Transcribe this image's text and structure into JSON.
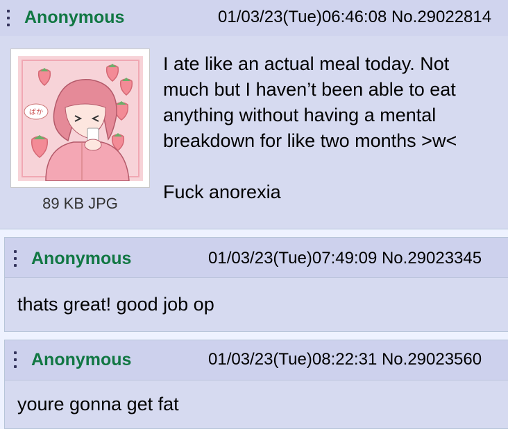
{
  "op": {
    "name": "Anonymous",
    "datetime": "01/03/23(Tue)06:46:08",
    "number": "No.29022814",
    "file_info": "89 KB JPG",
    "message_lines": [
      "I ate like an actual meal today. Not",
      "much but I haven’t been able to eat",
      "anything without having a mental",
      "breakdown for like two months >w<"
    ],
    "message_footer": "Fuck anorexia",
    "thumbnail_text": "ばか"
  },
  "replies": [
    {
      "name": "Anonymous",
      "datetime": "01/03/23(Tue)07:49:09",
      "number": "No.29023345",
      "message": "thats great! good job op"
    },
    {
      "name": "Anonymous",
      "datetime": "01/03/23(Tue)08:22:31",
      "number": "No.29023560",
      "message": "youre gonna get fat"
    }
  ],
  "colors": {
    "page_bg": "#eef2ff",
    "post_bg": "#d6daf0",
    "name_green": "#117743",
    "border": "#b7c5d9"
  }
}
